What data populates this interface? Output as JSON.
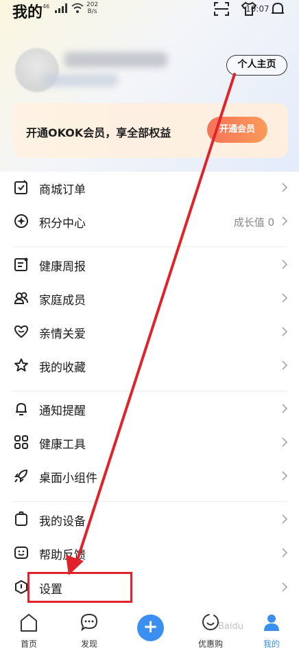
{
  "status_bar": {
    "title": "我的",
    "signal": "46",
    "net_speed_value": "202",
    "net_speed_unit": "B/s",
    "time": "10:07"
  },
  "profile": {
    "homepage_label": "个人主页"
  },
  "vip": {
    "text": "开通OKOK会员，享全部权益",
    "button": "开通会员"
  },
  "menu_groups": [
    [
      {
        "label": "商城订单",
        "icon": "order-icon"
      },
      {
        "label": "积分中心",
        "icon": "points-icon",
        "extra": "成长值 0"
      }
    ],
    [
      {
        "label": "健康周报",
        "icon": "report-icon"
      },
      {
        "label": "家庭成员",
        "icon": "family-icon"
      },
      {
        "label": "亲情关爱",
        "icon": "heart-icon"
      },
      {
        "label": "我的收藏",
        "icon": "star-icon"
      }
    ],
    [
      {
        "label": "通知提醒",
        "icon": "bell-icon"
      },
      {
        "label": "健康工具",
        "icon": "grid-icon"
      },
      {
        "label": "桌面小组件",
        "icon": "rocket-icon"
      }
    ],
    [
      {
        "label": "我的设备",
        "icon": "device-icon"
      },
      {
        "label": "帮助反馈",
        "icon": "smile-icon"
      },
      {
        "label": "设置",
        "icon": "settings-icon"
      }
    ]
  ],
  "bottom_nav": {
    "home": "首页",
    "discover": "发现",
    "shop": "优惠购",
    "mine": "我的"
  },
  "watermark": "Baidu",
  "colors": {
    "accent_blue": "#3b8ff0",
    "vip_orange": "#f6735a",
    "annotation_red": "#e0232b"
  }
}
